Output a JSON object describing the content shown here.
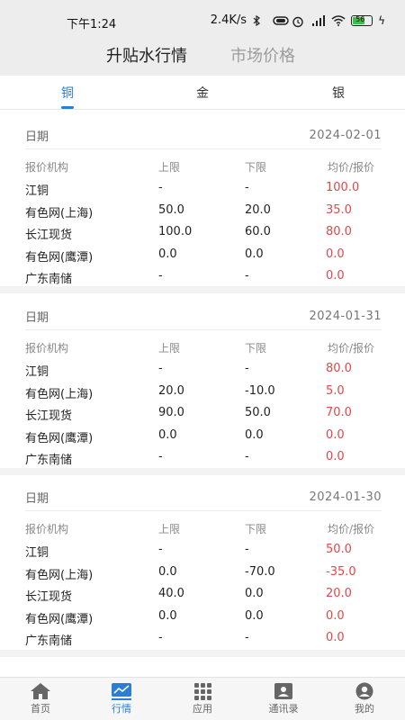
{
  "status_bar": {
    "time": "下午1:24",
    "speed": "2.4K/s",
    "battery": "56"
  },
  "header": {
    "tabs": [
      "升贴水行情",
      "市场价格"
    ]
  },
  "metal_tabs": [
    "铜",
    "金",
    "银"
  ],
  "columns": [
    "报价机构",
    "上限",
    "下限",
    "均价/报价"
  ],
  "date_label": "日期",
  "sections": [
    {
      "date": "2024-02-01",
      "rows": [
        [
          "江铜",
          "-",
          "-",
          "100.0"
        ],
        [
          "有色网(上海)",
          "50.0",
          "20.0",
          "35.0"
        ],
        [
          "长江现货",
          "100.0",
          "60.0",
          "80.0"
        ],
        [
          "有色网(鹰潭)",
          "0.0",
          "0.0",
          "0.0"
        ],
        [
          "广东南储",
          "-",
          "-",
          "0.0"
        ]
      ]
    },
    {
      "date": "2024-01-31",
      "rows": [
        [
          "江铜",
          "-",
          "-",
          "80.0"
        ],
        [
          "有色网(上海)",
          "20.0",
          "-10.0",
          "5.0"
        ],
        [
          "长江现货",
          "90.0",
          "50.0",
          "70.0"
        ],
        [
          "有色网(鹰潭)",
          "0.0",
          "0.0",
          "0.0"
        ],
        [
          "广东南储",
          "-",
          "-",
          "0.0"
        ]
      ]
    },
    {
      "date": "2024-01-30",
      "rows": [
        [
          "江铜",
          "-",
          "-",
          "50.0"
        ],
        [
          "有色网(上海)",
          "0.0",
          "-70.0",
          "-35.0"
        ],
        [
          "长江现货",
          "40.0",
          "0.0",
          "20.0"
        ],
        [
          "有色网(鹰潭)",
          "0.0",
          "0.0",
          "0.0"
        ],
        [
          "广东南储",
          "-",
          "-",
          "0.0"
        ]
      ]
    }
  ],
  "bottom_nav": [
    {
      "label": "首页",
      "icon": "home-icon"
    },
    {
      "label": "行情",
      "icon": "chart-icon"
    },
    {
      "label": "应用",
      "icon": "grid-icon"
    },
    {
      "label": "通讯录",
      "icon": "contacts-icon"
    },
    {
      "label": "我的",
      "icon": "profile-icon"
    }
  ],
  "colors": {
    "accent": "#2a7fd4",
    "price": "#e0474a"
  }
}
